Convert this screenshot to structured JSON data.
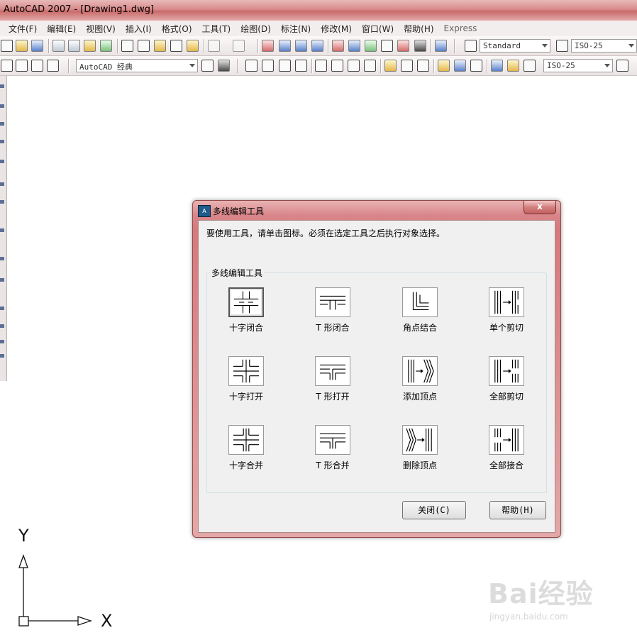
{
  "window": {
    "title": "AutoCAD 2007 - [Drawing1.dwg]"
  },
  "menu": [
    {
      "label": "文件(F)"
    },
    {
      "label": "编辑(E)"
    },
    {
      "label": "视图(V)"
    },
    {
      "label": "插入(I)"
    },
    {
      "label": "格式(O)"
    },
    {
      "label": "工具(T)"
    },
    {
      "label": "绘图(D)"
    },
    {
      "label": "标注(N)"
    },
    {
      "label": "修改(M)"
    },
    {
      "label": "窗口(W)"
    },
    {
      "label": "帮助(H)"
    },
    {
      "label": "Express"
    }
  ],
  "toolbar": {
    "text_style": "Standard",
    "dim_style_1": "ISO-25",
    "workspace": "AutoCAD 经典",
    "dim_style_2": "ISO-25"
  },
  "ucs": {
    "x_label": "X",
    "y_label": "Y"
  },
  "watermark": {
    "brand": "Bai经验",
    "url": "jingyan.baidu.com"
  },
  "dialog": {
    "title": "多线编辑工具",
    "close_glyph": "x",
    "hint": "要使用工具，请单击图标。必须在选定工具之后执行对象选择。",
    "group_label": "多线编辑工具",
    "tools": [
      {
        "label": "十字闭合",
        "icon": "cross-closed-icon"
      },
      {
        "label": "T 形闭合",
        "icon": "tee-closed-icon"
      },
      {
        "label": "角点结合",
        "icon": "corner-joint-icon"
      },
      {
        "label": "单个剪切",
        "icon": "cut-single-icon"
      },
      {
        "label": "十字打开",
        "icon": "cross-open-icon"
      },
      {
        "label": "T 形打开",
        "icon": "tee-open-icon"
      },
      {
        "label": "添加顶点",
        "icon": "add-vertex-icon"
      },
      {
        "label": "全部剪切",
        "icon": "cut-all-icon"
      },
      {
        "label": "十字合并",
        "icon": "cross-merged-icon"
      },
      {
        "label": "T 形合并",
        "icon": "tee-merged-icon"
      },
      {
        "label": "删除顶点",
        "icon": "delete-vertex-icon"
      },
      {
        "label": "全部接合",
        "icon": "weld-all-icon"
      }
    ],
    "close_button": "关闭(C)",
    "help_button": "帮助(H)"
  }
}
